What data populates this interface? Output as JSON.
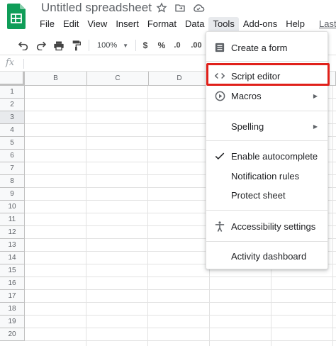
{
  "app": {
    "title": "Untitled spreadsheet",
    "brand_color": "#0f9d58"
  },
  "menubar": {
    "items": [
      "File",
      "Edit",
      "View",
      "Insert",
      "Format",
      "Data",
      "Tools",
      "Add-ons",
      "Help"
    ],
    "active": "Tools",
    "last_edit": "Last e"
  },
  "toolbar": {
    "zoom": "100%",
    "currency": "$",
    "percent": "%",
    "decrease_decimal": ".0",
    "increase_decimal": ".00"
  },
  "formula_bar": {
    "fx": "fx"
  },
  "grid": {
    "columns": [
      "B",
      "C",
      "D"
    ],
    "rows": [
      "1",
      "2",
      "3",
      "4",
      "5",
      "6",
      "7",
      "8",
      "9",
      "10",
      "11",
      "12",
      "13",
      "14",
      "15",
      "16",
      "17",
      "18",
      "19",
      "20"
    ]
  },
  "tools_menu": {
    "items": [
      {
        "label": "Create a form",
        "icon": "form-icon",
        "submenu": false
      },
      {
        "label": "Script editor",
        "icon": "code-icon",
        "submenu": false,
        "highlighted": true
      },
      {
        "label": "Macros",
        "icon": "play-circle-icon",
        "submenu": true
      },
      {
        "label": "Spelling",
        "icon": "",
        "submenu": true
      },
      {
        "label": "Enable autocomplete",
        "icon": "check-icon",
        "submenu": false
      },
      {
        "label": "Notification rules",
        "icon": "",
        "submenu": false
      },
      {
        "label": "Protect sheet",
        "icon": "",
        "submenu": false
      },
      {
        "label": "Accessibility settings",
        "icon": "accessibility-icon",
        "submenu": false
      },
      {
        "label": "Activity dashboard",
        "icon": "",
        "submenu": false
      }
    ],
    "highlight_color": "#e0201a"
  }
}
